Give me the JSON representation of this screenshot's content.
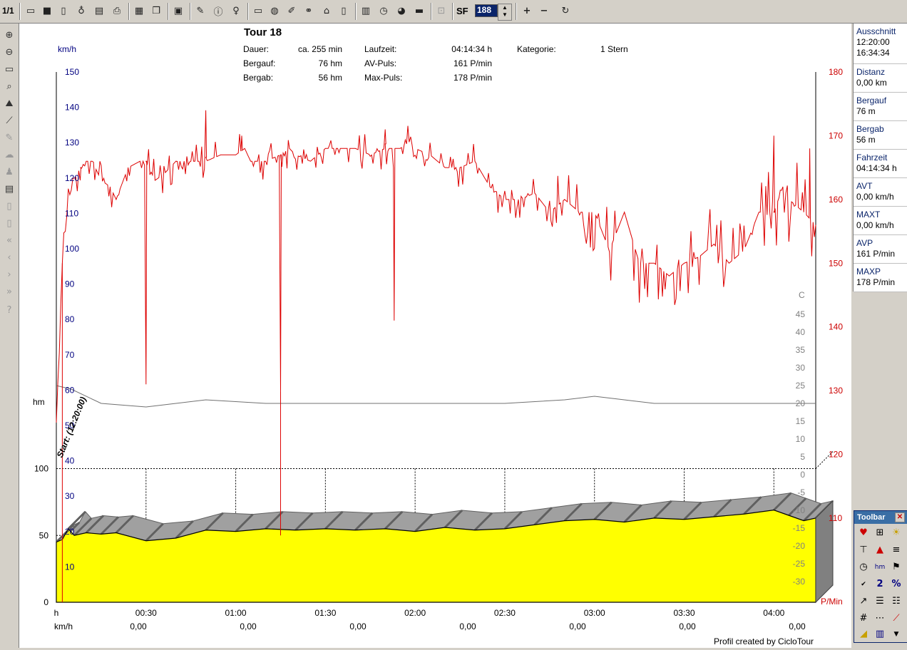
{
  "toolbar": {
    "page_indicator": "1/1",
    "sf_label": "SF",
    "sf_value": "188",
    "icons": [
      "open-icon",
      "save-icon",
      "page-icon",
      "hat-icon",
      "print-setup-icon",
      "print-icon",
      "table-icon",
      "copy-icon",
      "clipboard-icon",
      "talk-icon",
      "info-icon",
      "bulb-icon",
      "window-icon",
      "globe-icon",
      "edit-icon",
      "bike-icon",
      "tape-icon",
      "file-icon",
      "film-icon",
      "stopwatch-icon",
      "pie-icon",
      "bar-icon",
      "zoom-plus-icon",
      "zoom-minus-icon",
      "refresh-icon"
    ]
  },
  "header": {
    "title": "Tour 18",
    "rows": [
      {
        "l1": "Dauer:",
        "v1": "ca. 255 min",
        "l2": "Laufzeit:",
        "v2": "04:14:34 h",
        "l3": "Kategorie:",
        "v3": "1 Stern"
      },
      {
        "l1": "Bergauf:",
        "v1": "76 hm",
        "l2": "AV-Puls:",
        "v2": "161 P/min",
        "l3": "",
        "v3": ""
      },
      {
        "l1": "Bergab:",
        "v1": "56 hm",
        "l2": "Max-Puls:",
        "v2": "178 P/min",
        "l3": "",
        "v3": ""
      }
    ]
  },
  "chart_data": {
    "type": "line",
    "left_speed_axis": {
      "label": "km/h",
      "ticks": [
        150,
        140,
        130,
        120,
        110,
        100,
        90,
        80,
        70,
        60,
        50,
        40,
        30,
        20,
        10
      ],
      "color": "#000080"
    },
    "left_height_axis": {
      "label": "hm",
      "ticks": [
        100,
        50,
        0
      ]
    },
    "right_pulse_axis": {
      "label": "P/Min",
      "ticks": [
        180,
        170,
        160,
        150,
        140,
        130,
        120,
        110
      ],
      "color": "#cc0000"
    },
    "temp_axis": {
      "label": "C",
      "ticks": [
        45,
        40,
        35,
        30,
        25,
        20,
        15,
        10,
        5,
        0,
        -5,
        -10,
        -15,
        -20,
        -25,
        -30
      ]
    },
    "x_ticks": [
      "h",
      "00:30",
      "01:00",
      "01:30",
      "02:00",
      "02:30",
      "03:00",
      "03:30",
      "04:00"
    ],
    "x_speed_row": {
      "label": "km/h",
      "values": [
        "0,00",
        "0,00",
        "0,00",
        "0,00",
        "0,00",
        "0,00",
        "0,00"
      ]
    },
    "start_label": "Start: (12:20:00)",
    "credit": "Profil created by CicloTour",
    "pulse_series": {
      "name": "Puls",
      "x_minutes": [
        0,
        2,
        4,
        6,
        8,
        10,
        12,
        15,
        18,
        20,
        24,
        28,
        30,
        33,
        36,
        40,
        45,
        50,
        55,
        60,
        63,
        65,
        70,
        75,
        78,
        80,
        85,
        90,
        95,
        100,
        105,
        110,
        115,
        118,
        120,
        125,
        130,
        135,
        140,
        145,
        150,
        155,
        160,
        165,
        170,
        175,
        180,
        185,
        190,
        195,
        200,
        205,
        210,
        215,
        220,
        225,
        230,
        235,
        240,
        243,
        245,
        250,
        254
      ],
      "values": [
        125,
        150,
        160,
        163,
        165,
        166,
        166,
        163,
        162,
        160,
        165,
        166,
        166,
        163,
        164,
        166,
        166,
        166,
        167,
        167,
        168,
        166,
        166,
        167,
        168,
        167,
        166,
        168,
        168,
        168,
        167,
        168,
        168,
        169,
        168,
        167,
        165,
        165,
        166,
        162,
        160,
        160,
        161,
        158,
        160,
        158,
        158,
        152,
        158,
        150,
        150,
        148,
        150,
        151,
        153,
        150,
        152,
        158,
        158,
        162,
        160,
        158,
        156
      ],
      "spikes": [
        {
          "x": 8,
          "v": 163
        },
        {
          "x": 30,
          "v": 131
        },
        {
          "x": 50,
          "v": 174
        },
        {
          "x": 62,
          "v": 170
        },
        {
          "x": 75,
          "v": 130
        },
        {
          "x": 110,
          "v": 171
        },
        {
          "x": 113,
          "v": 141
        },
        {
          "x": 240,
          "v": 170
        },
        {
          "x": 252,
          "v": 168
        }
      ]
    },
    "temp_series": {
      "name": "Temperatur",
      "x_minutes": [
        0,
        5,
        15,
        30,
        40,
        50,
        70,
        90,
        110,
        130,
        150,
        170,
        180,
        190,
        200,
        220,
        240,
        254
      ],
      "values": [
        25,
        24,
        20,
        19,
        20,
        21,
        20,
        20,
        20,
        20,
        20,
        21,
        22,
        21,
        20,
        20,
        20,
        20
      ]
    },
    "height_series": {
      "name": "Höhe",
      "x_minutes": [
        0,
        2,
        4,
        6,
        10,
        15,
        20,
        30,
        40,
        50,
        60,
        70,
        80,
        90,
        100,
        110,
        120,
        130,
        140,
        150,
        160,
        170,
        180,
        190,
        200,
        210,
        220,
        230,
        240,
        245,
        250,
        254
      ],
      "values": [
        45,
        47,
        55,
        50,
        52,
        51,
        52,
        46,
        48,
        54,
        53,
        55,
        54,
        55,
        54,
        55,
        53,
        56,
        54,
        55,
        58,
        61,
        62,
        60,
        63,
        62,
        64,
        66,
        69,
        65,
        61,
        63
      ]
    }
  },
  "stats": [
    {
      "label": "Ausschnitt",
      "values": [
        "12:20:00",
        "16:34:34"
      ]
    },
    {
      "label": "Distanz",
      "values": [
        "0,00 km"
      ]
    },
    {
      "label": "Bergauf",
      "values": [
        "76 m"
      ]
    },
    {
      "label": "Bergab",
      "values": [
        "56 m"
      ]
    },
    {
      "label": "Fahrzeit",
      "values": [
        "04:14:34 h"
      ]
    },
    {
      "label": "AVT",
      "values": [
        "0,00 km/h"
      ]
    },
    {
      "label": "MAXT",
      "values": [
        "0,00 km/h"
      ]
    },
    {
      "label": "AVP",
      "values": [
        "161 P/min"
      ]
    },
    {
      "label": "MAXP",
      "values": [
        "178 P/min"
      ]
    }
  ],
  "mini_toolbar": {
    "title": "Toolbar",
    "icons": [
      "heart-icon",
      "camera-icon",
      "sun-icon",
      "shirt-icon",
      "warning-icon",
      "lines-icon",
      "clock-icon",
      "hm-icon",
      "flag-icon",
      "abc-check-icon",
      "two-icon",
      "percent-icon",
      "arrow-icon",
      "equal-icon",
      "list-icon",
      "grid-icon",
      "dash-icon",
      "chart-icon",
      "area-icon",
      "bars-icon",
      "dropdown-icon"
    ]
  }
}
